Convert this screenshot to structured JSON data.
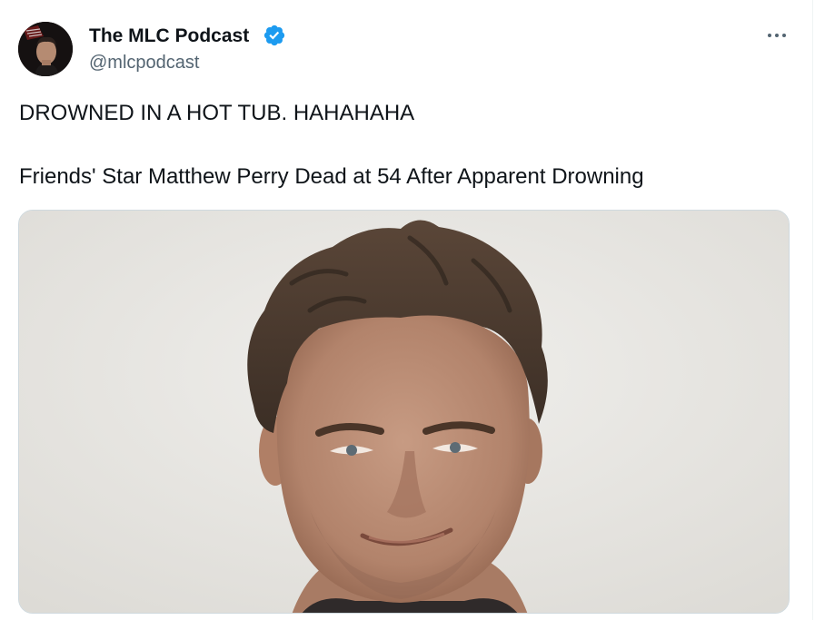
{
  "author": {
    "display_name": "The MLC Podcast",
    "handle": "@mlcpodcast",
    "verified": true,
    "verified_color": "#1d9bf0"
  },
  "tweet": {
    "lines": [
      "DROWNED IN A HOT TUB. HAHAHAHA",
      "Friends' Star Matthew Perry Dead at 54 After Apparent Drowning"
    ]
  },
  "icons": {
    "more": "more-horizontal-icon",
    "verified": "verified-badge-icon"
  },
  "colors": {
    "text": "#0f1419",
    "secondary_text": "#536471",
    "border": "#cfd9de",
    "accent": "#1d9bf0"
  }
}
